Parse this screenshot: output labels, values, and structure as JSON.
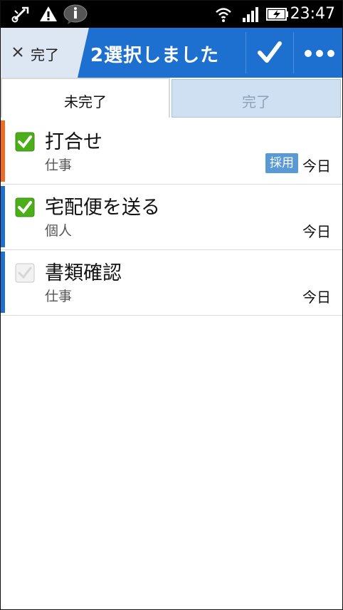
{
  "status_bar": {
    "time": "23:47",
    "icons": [
      "usb-debug-icon",
      "warning-icon",
      "info-icon",
      "wifi-icon",
      "signal-icon",
      "battery-charging-icon"
    ]
  },
  "action_bar": {
    "done_label": "完了",
    "selection_title": "2選択しました",
    "confirm_icon": "check-icon",
    "more_icon": "more-dots-icon",
    "color": "#1d6fd0"
  },
  "tabs": [
    {
      "label": "未完了",
      "active": true
    },
    {
      "label": "完了",
      "active": false
    }
  ],
  "tasks": [
    {
      "title": "打合せ",
      "category": "仕事",
      "due": "今日",
      "badge": "採用",
      "checked": true,
      "color": "#f06a1f"
    },
    {
      "title": "宅配便を送る",
      "category": "個人",
      "due": "今日",
      "checked": true,
      "color": "#1d6fd0"
    },
    {
      "title": "書類確認",
      "category": "仕事",
      "due": "今日",
      "checked": false,
      "color": "#1d6fd0"
    }
  ]
}
